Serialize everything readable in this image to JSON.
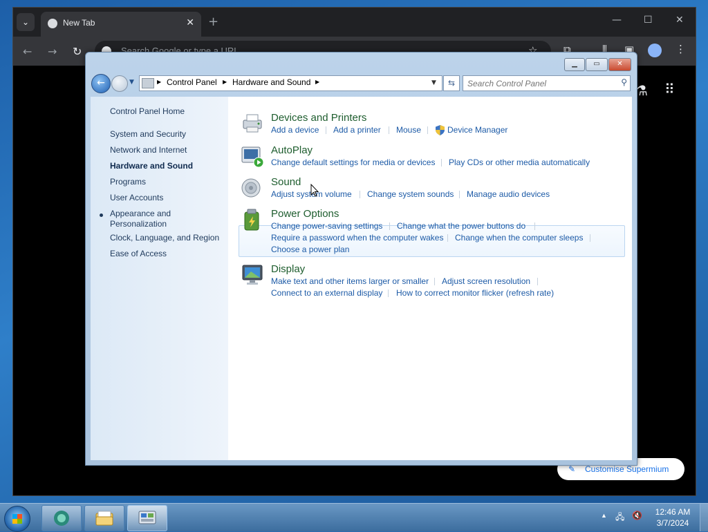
{
  "browser": {
    "tab_title": "New Tab",
    "omnibox_placeholder": "Search Google or type a URL",
    "customise_label": "Customise Supermium"
  },
  "window": {
    "buttons": {
      "minimize": "▭",
      "maximize": "☐",
      "close": "✕"
    }
  },
  "address": {
    "crumbs": [
      "Control Panel",
      "Hardware and Sound"
    ],
    "search_placeholder": "Search Control Panel"
  },
  "left_pane": {
    "home": "Control Panel Home",
    "items": [
      {
        "label": "System and Security",
        "active": false
      },
      {
        "label": "Network and Internet",
        "active": false
      },
      {
        "label": "Hardware and Sound",
        "active": true
      },
      {
        "label": "Programs",
        "active": false
      },
      {
        "label": "User Accounts",
        "active": false
      },
      {
        "label": "Appearance and\nPersonalization",
        "active": false
      },
      {
        "label": "Clock, Language, and Region",
        "active": false
      },
      {
        "label": "Ease of Access",
        "active": false
      }
    ]
  },
  "categories": {
    "devices": {
      "title": "Devices and Printers",
      "links": [
        "Add a device",
        "Add a printer",
        "Mouse",
        "Device Manager"
      ]
    },
    "autoplay": {
      "title": "AutoPlay",
      "links": [
        "Change default settings for media or devices",
        "Play CDs or other media automatically"
      ]
    },
    "sound": {
      "title": "Sound",
      "links": [
        "Adjust system volume",
        "Change system sounds",
        "Manage audio devices"
      ]
    },
    "power": {
      "title": "Power Options",
      "links": [
        "Change power-saving settings",
        "Change what the power buttons do",
        "Require a password when the computer wakes",
        "Change when the computer sleeps",
        "Choose a power plan"
      ]
    },
    "display": {
      "title": "Display",
      "links": [
        "Make text and other items larger or smaller",
        "Adjust screen resolution",
        "Connect to an external display",
        "How to correct monitor flicker (refresh rate)"
      ]
    }
  },
  "taskbar": {
    "time": "12:46 AM",
    "date": "3/7/2024"
  }
}
